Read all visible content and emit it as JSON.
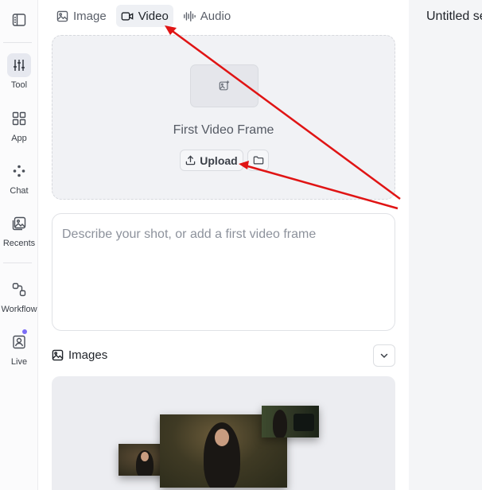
{
  "rail": {
    "items": [
      {
        "label": "Tool",
        "icon": "sliders-icon",
        "active": true
      },
      {
        "label": "App",
        "icon": "grid-icon",
        "active": false
      },
      {
        "label": "Chat",
        "icon": "dots-icon",
        "active": false
      },
      {
        "label": "Recents",
        "icon": "gallery-icon",
        "active": false
      },
      {
        "label": "Workflow",
        "icon": "flow-icon",
        "active": false
      },
      {
        "label": "Live",
        "icon": "live-icon",
        "active": false
      }
    ]
  },
  "tabs": [
    {
      "label": "Image",
      "icon": "image-icon",
      "active": false
    },
    {
      "label": "Video",
      "icon": "video-icon",
      "active": true
    },
    {
      "label": "Audio",
      "icon": "audio-wave-icon",
      "active": false
    }
  ],
  "upload": {
    "title": "First Video Frame",
    "upload_label": "Upload"
  },
  "prompt": {
    "placeholder": "Describe your shot, or add a first video frame"
  },
  "images": {
    "label": "Images"
  },
  "document": {
    "title": "Untitled se"
  },
  "colors": {
    "accent_dot": "#7b6cf6",
    "annotation_arrow": "#e01414"
  }
}
